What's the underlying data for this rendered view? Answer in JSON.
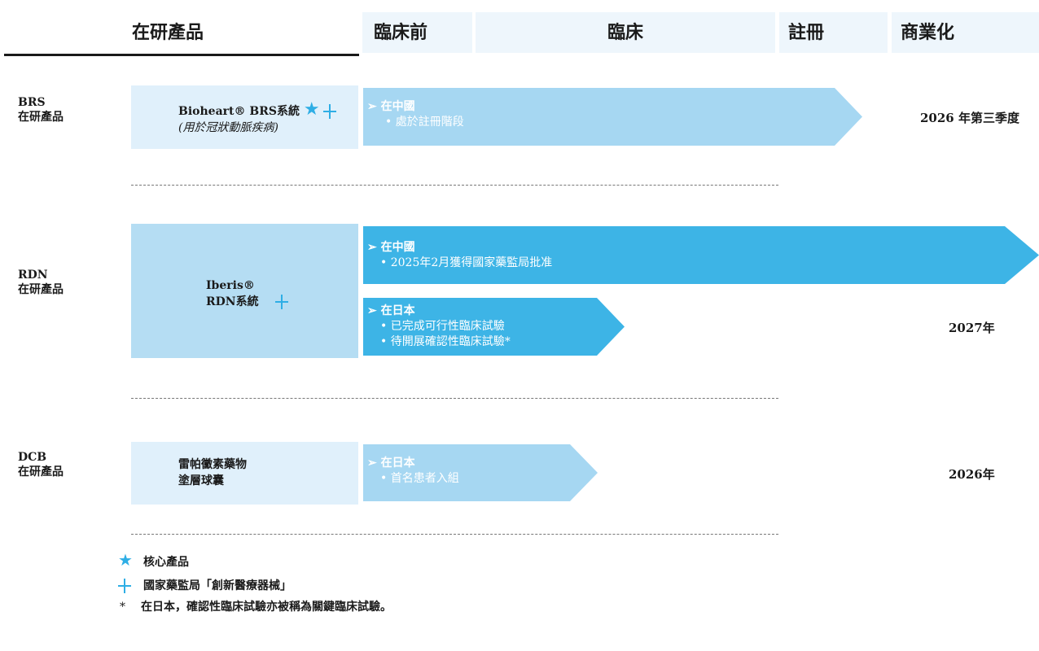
{
  "header": {
    "product": "在研產品",
    "preclinical": "臨床前",
    "clinical": "臨床",
    "registration": "註冊",
    "commercialization": "商業化"
  },
  "rows": [
    {
      "label_line1": "BRS",
      "label_line2": "在研產品",
      "product_name": "Bioheart® BRS系統",
      "product_sub": "(用於冠狀動脈疾病)",
      "markers": [
        "star-icon",
        "cross-icon"
      ],
      "arrows": [
        {
          "title": "在中國",
          "bullets": [
            "處於註冊階段"
          ]
        }
      ],
      "commercialization": "2026 年第三季度"
    },
    {
      "label_line1": "RDN",
      "label_line2": "在研產品",
      "product_name_line1": "Iberis®",
      "product_name_line2": "RDN系統",
      "markers": [
        "cross-icon"
      ],
      "arrows": [
        {
          "title": "在中國",
          "bullets": [
            "2025年2月獲得國家藥監局批准"
          ]
        },
        {
          "title": "在日本",
          "bullets": [
            "已完成可行性臨床試驗",
            "待開展確認性臨床試驗*"
          ]
        }
      ],
      "commercialization": "2027年"
    },
    {
      "label_line1": "DCB",
      "label_line2": "在研產品",
      "product_name_line1": "雷帕黴素藥物",
      "product_name_line2": "塗層球囊",
      "arrows": [
        {
          "title": "在日本",
          "bullets": [
            "首名患者入組"
          ]
        }
      ],
      "commercialization": "2026年"
    }
  ],
  "legend": [
    {
      "symbol": "★",
      "text": "核心產品"
    },
    {
      "symbol": "+",
      "text": "國家藥監局「創新醫療器械」"
    },
    {
      "symbol": "*",
      "text": "在日本，確認性臨床試驗亦被稱為關鍵臨床試驗。"
    }
  ],
  "colors": {
    "header_bg": "#eef6fc",
    "pale_arrow": "#a6d7f2",
    "strong_arrow": "#3db4e6",
    "accent": "#2eaee5"
  }
}
